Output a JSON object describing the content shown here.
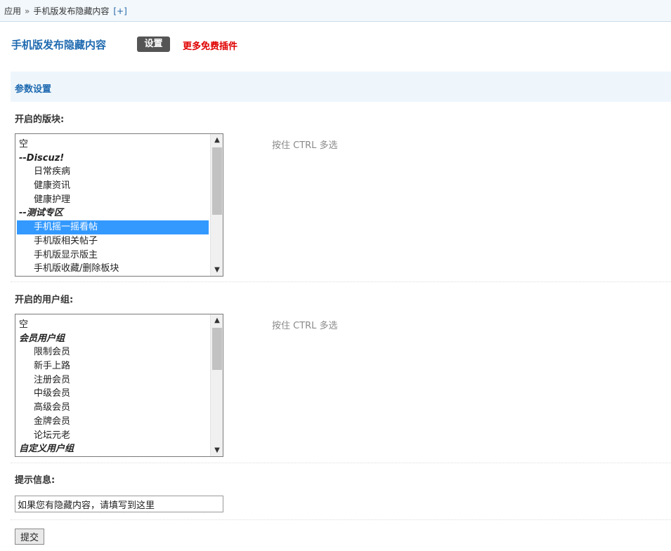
{
  "breadcrumb": {
    "root": "应用",
    "separator": "»",
    "current": "手机版发布隐藏内容",
    "add": "[+]"
  },
  "header": {
    "title": "手机版发布隐藏内容",
    "settings_label": "设置",
    "more_plugins": "更多免费插件"
  },
  "section": {
    "title": "参数设置"
  },
  "forums": {
    "label": "开启的版块:",
    "hint": "按住 CTRL 多选",
    "options": [
      {
        "text": "空",
        "kind": "plain"
      },
      {
        "text": "--Discuz!",
        "kind": "group"
      },
      {
        "text": "日常疾病",
        "kind": "sub"
      },
      {
        "text": "健康资讯",
        "kind": "sub"
      },
      {
        "text": "健康护理",
        "kind": "sub"
      },
      {
        "text": "--测试专区",
        "kind": "group"
      },
      {
        "text": "手机摇一摇看帖",
        "kind": "sub",
        "selected": true
      },
      {
        "text": "手机版相关帖子",
        "kind": "sub"
      },
      {
        "text": "手机版显示版主",
        "kind": "sub"
      },
      {
        "text": "手机版收藏/删除板块",
        "kind": "sub"
      }
    ]
  },
  "usergroups": {
    "label": "开启的用户组:",
    "hint": "按住 CTRL 多选",
    "options": [
      {
        "text": "空",
        "kind": "plain"
      },
      {
        "text": "会员用户组",
        "kind": "group"
      },
      {
        "text": "限制会员",
        "kind": "sub"
      },
      {
        "text": "新手上路",
        "kind": "sub"
      },
      {
        "text": "注册会员",
        "kind": "sub"
      },
      {
        "text": "中级会员",
        "kind": "sub"
      },
      {
        "text": "高级会员",
        "kind": "sub"
      },
      {
        "text": "金牌会员",
        "kind": "sub"
      },
      {
        "text": "论坛元老",
        "kind": "sub"
      },
      {
        "text": "自定义用户组",
        "kind": "group"
      }
    ]
  },
  "tip": {
    "label": "提示信息:",
    "value": "如果您有隐藏内容，请填写到这里"
  },
  "submit_label": "提交",
  "icons": {
    "scroll_up": "chevron-up-icon",
    "scroll_down": "chevron-down-icon"
  }
}
